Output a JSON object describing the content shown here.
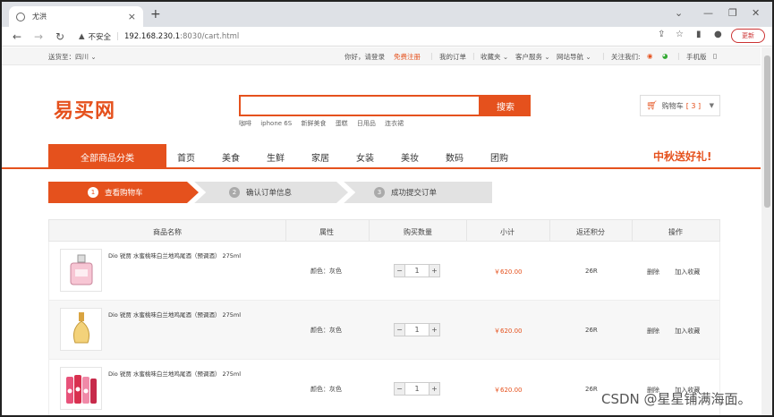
{
  "browser": {
    "tab_title": "尤洪",
    "security_label": "不安全",
    "url_host": "192.168.230.1",
    "url_path": ":8030/cart.html",
    "update_label": "更新"
  },
  "topnav": {
    "ship_to": "送货至：四川",
    "greeting": "你好，请登录",
    "register": "免费注册",
    "my_orders": "我的订单",
    "favorites": "收藏夹",
    "service": "客户服务",
    "site_nav": "网站导航",
    "follow": "关注我们:",
    "mobile": "手机版"
  },
  "header": {
    "logo": "易买网",
    "search_value": "",
    "search_button": "搜索",
    "hot_words": [
      "咖啡",
      "iphone 6S",
      "新鲜美食",
      "蛋糕",
      "日用品",
      "连衣裙"
    ],
    "cart_label": "购物车",
    "cart_count": "[ 3 ]"
  },
  "navbar": {
    "all_categories": "全部商品分类",
    "items": [
      "首页",
      "美食",
      "生鲜",
      "家居",
      "女装",
      "美妆",
      "数码",
      "团购"
    ],
    "promo": "中秋送好礼!"
  },
  "steps": [
    {
      "num": "1",
      "label": "查看购物车",
      "active": true
    },
    {
      "num": "2",
      "label": "确认订单信息",
      "active": false
    },
    {
      "num": "3",
      "label": "成功提交订单",
      "active": false
    }
  ],
  "cart_table": {
    "headers": [
      "商品名称",
      "属性",
      "购买数量",
      "小计",
      "返还积分",
      "操作"
    ],
    "rows": [
      {
        "name": "Dio 锐贾 水蜜桃味白兰地鸡尾酒（预调酒） 275ml",
        "attr": "颜色：灰色",
        "qty": "1",
        "subtotal": "￥620.00",
        "points": "26R",
        "delete": "删除",
        "favorite": "加入收藏"
      },
      {
        "name": "Dio 锐贾 水蜜桃味白兰地鸡尾酒（预调酒） 275ml",
        "attr": "颜色：灰色",
        "qty": "1",
        "subtotal": "￥620.00",
        "points": "26R",
        "delete": "删除",
        "favorite": "加入收藏"
      },
      {
        "name": "Dio 锐贾 水蜜桃味白兰地鸡尾酒（预调酒） 275ml",
        "attr": "颜色：灰色",
        "qty": "1",
        "subtotal": "￥620.00",
        "points": "26R",
        "delete": "删除",
        "favorite": "加入收藏"
      }
    ]
  },
  "watermark": "CSDN @星星铺满海面。",
  "colors": {
    "accent": "#e5511d"
  }
}
